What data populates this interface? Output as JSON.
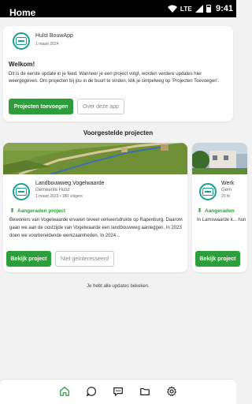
{
  "status_bar": {
    "network": "LTE",
    "time": "9:41"
  },
  "header": {
    "title": "Home"
  },
  "welcome": {
    "app_name": "Hulst BouwApp",
    "date": "1 maart 2024",
    "title": "Welkom!",
    "body": "Dit is de eerste update in je feed. Wanneer je een project volgt, worden verdere updates hier weergegeven. Om projecten bij jou in de buurt te vinden, klik je simpelweg op 'Projecten Toevoegen'.",
    "primary_button": "Projecten toevoegen",
    "secondary_button": "Over deze app"
  },
  "suggested": {
    "title": "Voorgestelde projecten",
    "projects": [
      {
        "name": "Landbouwweg Vogelwaarde",
        "org": "Gemeente Hulst",
        "meta": "1 maart 2023 • 180 volgers",
        "badge": "Aangeraden project",
        "description": "Bewoners van Vogelwaarde ervaren teveel verkeersdrukte op Rapenburg. Daarom gaan we aan de oostzijde van Vogelwaarde een landbouwweg aanleggen. In 2023 doen we voorbereidende werkzaamheden. In 2024...",
        "primary_button": "Bekijk project",
        "secondary_button": "Niet geïnteresseerd"
      },
      {
        "name": "Werk",
        "org": "Gem",
        "meta": "20 fe",
        "badge": "Aangeraden",
        "description": "In Lamswaarde k... hun cultuur... werken van DNV...",
        "primary_button": "Bekijk project"
      }
    ]
  },
  "footer_text": "Je hebt alle updates bekeken.",
  "nav": [
    "home-icon",
    "chat-icon",
    "messages-icon",
    "folder-icon",
    "settings-icon"
  ],
  "colors": {
    "accent": "#2e9e3a",
    "logo": "#19a08e"
  }
}
